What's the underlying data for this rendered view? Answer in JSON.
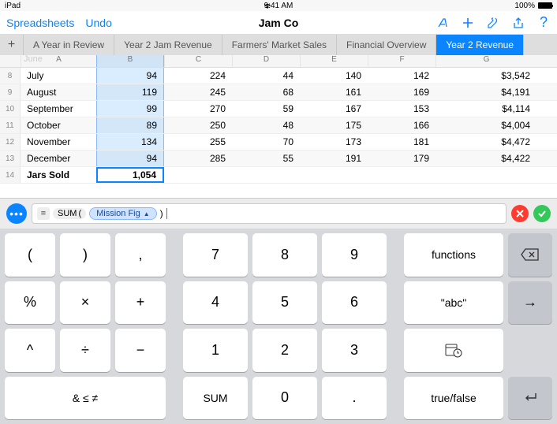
{
  "status": {
    "device": "iPad",
    "time": "9:41 AM",
    "battery": "100%"
  },
  "nav": {
    "back": "Spreadsheets",
    "undo": "Undo",
    "title": "Jam Co"
  },
  "tabs": [
    "A Year in Review",
    "Year 2 Jam Revenue",
    "Farmers' Market Sales",
    "Financial Overview",
    "Year 2 Revenue"
  ],
  "activeTab": 4,
  "colHeaders": [
    "A",
    "B",
    "C",
    "D",
    "E",
    "F",
    "G"
  ],
  "ghostMonth": "June",
  "rows": [
    {
      "rn": "8",
      "a": "July",
      "b": "94",
      "c": "224",
      "d": "44",
      "e": "140",
      "f": "142",
      "g": "$3,542"
    },
    {
      "rn": "9",
      "a": "August",
      "b": "119",
      "c": "245",
      "d": "68",
      "e": "161",
      "f": "169",
      "g": "$4,191"
    },
    {
      "rn": "10",
      "a": "September",
      "b": "99",
      "c": "270",
      "d": "59",
      "e": "167",
      "f": "153",
      "g": "$4,114"
    },
    {
      "rn": "11",
      "a": "October",
      "b": "89",
      "c": "250",
      "d": "48",
      "e": "175",
      "f": "166",
      "g": "$4,004"
    },
    {
      "rn": "12",
      "a": "November",
      "b": "134",
      "c": "255",
      "d": "70",
      "e": "173",
      "f": "181",
      "g": "$4,472"
    },
    {
      "rn": "13",
      "a": "December",
      "b": "94",
      "c": "285",
      "d": "55",
      "e": "191",
      "f": "179",
      "g": "$4,422"
    }
  ],
  "totalRow": {
    "rn": "14",
    "a": "Jars Sold",
    "b": "1,054"
  },
  "formula": {
    "fn": "SUM",
    "ref": "Mission Fig"
  },
  "keypad": {
    "r1": {
      "lparen": "(",
      "rparen": ")",
      "comma": ",",
      "n7": "7",
      "n8": "8",
      "n9": "9",
      "functions": "functions"
    },
    "r2": {
      "pct": "%",
      "mul": "×",
      "add": "+",
      "n4": "4",
      "n5": "5",
      "n6": "6",
      "abc": "\"abc\"",
      "arrow": "→"
    },
    "r3": {
      "caret": "^",
      "div": "÷",
      "sub": "−",
      "n1": "1",
      "n2": "2",
      "n3": "3"
    },
    "r4": {
      "logic": "& ≤ ≠",
      "sum": "SUM",
      "n0": "0",
      "dot": ".",
      "tf": "true/false",
      "ret": "↵"
    }
  }
}
